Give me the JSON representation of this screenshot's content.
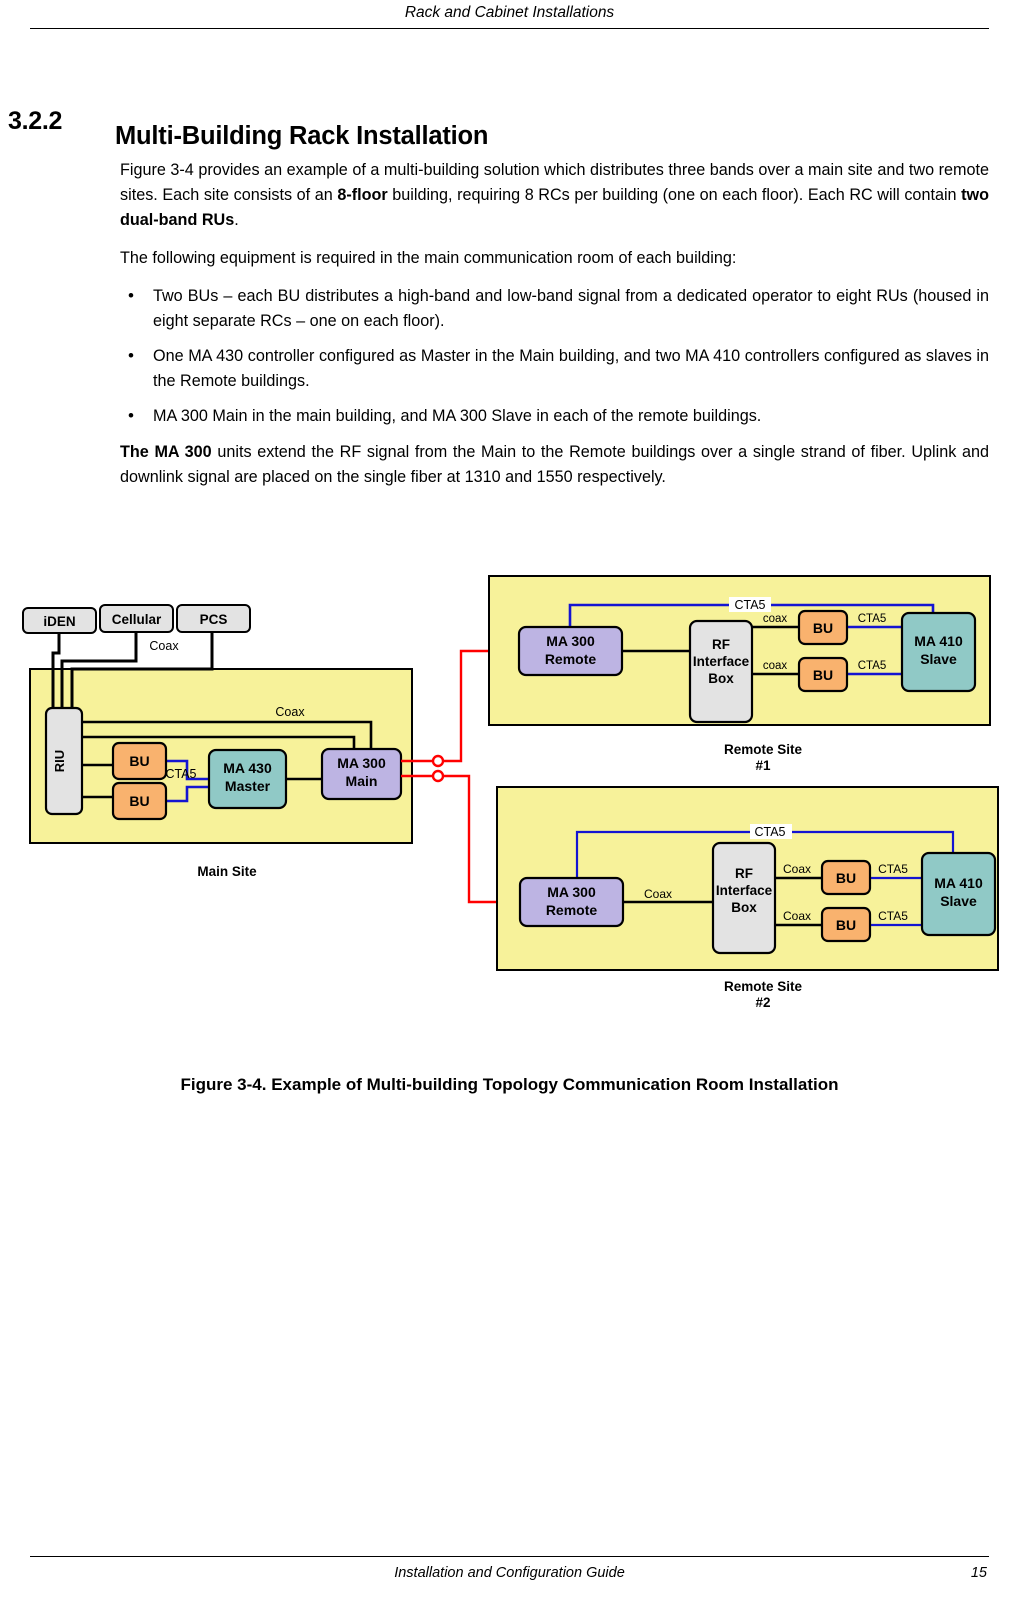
{
  "header": {
    "running_head": "Rack and Cabinet Installations"
  },
  "section": {
    "number": "3.2.2",
    "title": "Multi-Building Rack Installation"
  },
  "body": {
    "p1_a": "Figure 3-4 provides an example of a multi-building solution which distributes three bands over a main site and two remote sites. Each site consists of an ",
    "p1_b": "8-floor",
    "p1_c": " building, requiring 8 RCs per building (one on each floor). Each RC will contain ",
    "p1_d": "two dual-band RUs",
    "p1_e": ".",
    "p2": "The following equipment is required in the main communication room of each building:",
    "bullets": [
      "Two BUs – each BU distributes a high-band and low-band signal from a dedicated operator to eight RUs (housed in eight separate RCs – one on each floor).",
      "One MA 430 controller configured as Master in the Main building, and two MA 410 controllers configured as slaves in the Remote buildings.",
      "MA 300 Main in the main building, and MA 300 Slave in each of the remote buildings."
    ],
    "p3_a": "The MA 300",
    "p3_b": " units extend the RF signal from the Main to the Remote buildings over a single strand of fiber.  Uplink and downlink signal are placed on the single fiber at 1310 and 1550 respectively."
  },
  "figure": {
    "caption": "Figure 3-4. Example of Multi-building Topology Communication Room Installation",
    "colors": {
      "site_fill": "#F7F29A",
      "site_stroke": "#000000",
      "gray_box": "#E3E3E3",
      "orange_box": "#F9B26E",
      "teal_box": "#90C9C6",
      "purple_box": "#BDB4E3",
      "coax_wire": "#000000",
      "cta5_wire": "#1414D2",
      "fiber_wire": "#FF0000"
    },
    "main_site": {
      "label": "Main Site",
      "sources": [
        "iDEN",
        "Cellular",
        "PCS"
      ],
      "source_link_label": "Coax",
      "riu": "RIU",
      "bu_top": "BU",
      "bu_bottom": "BU",
      "cta5_label": "CTA5",
      "controller_line1": "MA 430",
      "controller_line2": "Master",
      "coax_label": "Coax",
      "ma300_line1": "MA 300",
      "ma300_line2": "Main"
    },
    "remote_site_1": {
      "label_line1": "Remote Site",
      "label_line2": "#1",
      "ma300_line1": "MA 300",
      "ma300_line2": "Remote",
      "rfbox_line1": "RF",
      "rfbox_line2": "Interface",
      "rfbox_line3": "Box",
      "cta5_top": "CTA5",
      "coax_top": "coax",
      "coax_bottom": "coax",
      "bu_top": "BU",
      "bu_bottom": "BU",
      "cta5_bu_top": "CTA5",
      "cta5_bu_bottom": "CTA5",
      "ma410_line1": "MA 410",
      "ma410_line2": "Slave"
    },
    "remote_site_2": {
      "label_line1": "Remote Site",
      "label_line2": "#2",
      "ma300_line1": "MA 300",
      "ma300_line2": "Remote",
      "ma300_link_label": "Coax",
      "rfbox_line1": "RF",
      "rfbox_line2": "Interface",
      "rfbox_line3": "Box",
      "cta5_top": "CTA5",
      "coax_top": "Coax",
      "coax_bottom": "Coax",
      "bu_top": "BU",
      "bu_bottom": "BU",
      "cta5_bu_top": "CTA5",
      "cta5_bu_bottom": "CTA5",
      "ma410_line1": "MA 410",
      "ma410_line2": "Slave"
    }
  },
  "footer": {
    "text": "Installation and Configuration Guide",
    "page_number": "15"
  }
}
